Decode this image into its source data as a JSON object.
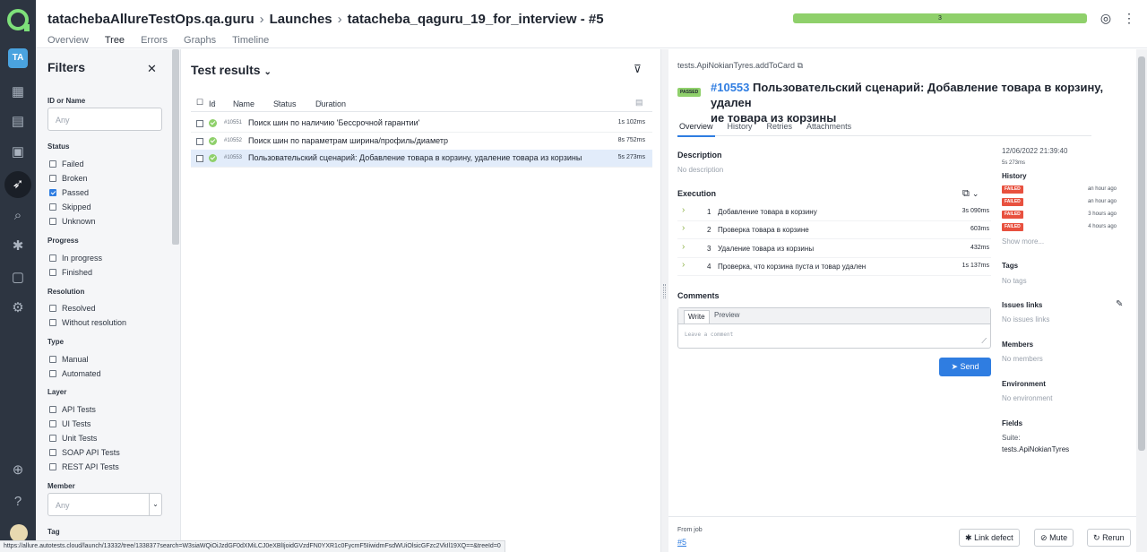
{
  "header": {
    "project": "tatachebaAllureTestOps.qa.guru",
    "section": "Launches",
    "launch": "tatacheba_qaguru_19_for_interview - #5",
    "tabs": [
      "Overview",
      "Tree",
      "Errors",
      "Graphs",
      "Timeline"
    ],
    "active_tab": "Tree",
    "progress_label": "3",
    "progress_fraction": 1.0
  },
  "rail": {
    "user_initials": "TA"
  },
  "filters": {
    "title": "Filters",
    "id_label": "ID or Name",
    "id_placeholder": "Any",
    "status_label": "Status",
    "status": [
      "Failed",
      "Broken",
      "Passed",
      "Skipped",
      "Unknown"
    ],
    "status_checked": "Passed",
    "progress_label": "Progress",
    "progress": [
      "In progress",
      "Finished"
    ],
    "resolution_label": "Resolution",
    "resolution": [
      "Resolved",
      "Without resolution"
    ],
    "type_label": "Type",
    "type": [
      "Manual",
      "Automated"
    ],
    "layer_label": "Layer",
    "layer": [
      "API Tests",
      "UI Tests",
      "Unit Tests",
      "SOAP API Tests",
      "REST API Tests"
    ],
    "member_label": "Member",
    "member_placeholder": "Any",
    "tag_label": "Tag"
  },
  "results": {
    "title": "Test results",
    "columns": [
      "Id",
      "Name",
      "Status",
      "Duration"
    ],
    "rows": [
      {
        "id": "#10551",
        "name": "Поиск шин по наличию 'Бессрочной гарантии'",
        "duration": "1s 102ms",
        "status": "passed"
      },
      {
        "id": "#10552",
        "name": "Поиск шин по параметрам ширина/профиль/диаметр",
        "duration": "8s 752ms",
        "status": "passed"
      },
      {
        "id": "#10553",
        "name": "Пользовательский сценарий: Добавление товара в корзину, удаление товара из корзины",
        "duration": "5s 273ms",
        "status": "passed",
        "selected": true
      }
    ]
  },
  "details": {
    "path": "tests.ApiNokianTyres.addToCard",
    "status": "PASSED",
    "id": "#10553",
    "title_line1": "Пользовательский сценарий: Добавление товара в корзину, удален",
    "title_line2": "ие товара из корзины",
    "tabs": [
      "Overview",
      "History",
      "Retries",
      "Attachments"
    ],
    "active_tab": "Overview",
    "description_label": "Description",
    "description": "No description",
    "execution_label": "Execution",
    "steps": [
      {
        "num": "1",
        "name": "Добавление товара в корзину",
        "duration": "3s 090ms"
      },
      {
        "num": "2",
        "name": "Проверка товара в корзине",
        "duration": "603ms"
      },
      {
        "num": "3",
        "name": "Удаление товара из корзины",
        "duration": "432ms"
      },
      {
        "num": "4",
        "name": "Проверка, что корзина пуста и товар удален",
        "duration": "1s 137ms"
      }
    ],
    "comments_label": "Comments",
    "comment_tabs": [
      "Write",
      "Preview"
    ],
    "comment_placeholder": "Leave a comment",
    "send_label": "Send",
    "date": "12/06/2022 21:39:40",
    "duration": "5s 273ms",
    "history_label": "History",
    "history": [
      {
        "status": "FAILED",
        "time": "an hour ago"
      },
      {
        "status": "FAILED",
        "time": "an hour ago"
      },
      {
        "status": "FAILED",
        "time": "3 hours ago"
      },
      {
        "status": "FAILED",
        "time": "4 hours ago"
      }
    ],
    "show_more": "Show more...",
    "tags_label": "Tags",
    "tags_empty": "No tags",
    "issues_label": "Issues links",
    "issues_empty": "No issues links",
    "members_label": "Members",
    "members_empty": "No members",
    "environment_label": "Environment",
    "environment_empty": "No environment",
    "fields_label": "Fields",
    "fields_key": "Suite:",
    "fields_value": "tests.ApiNokianTyres",
    "from_job_label": "From job",
    "from_job_link": "#5",
    "buttons": {
      "link_defect": "Link defect",
      "mute": "Mute",
      "rerun": "Rerun"
    }
  },
  "statusbar": {
    "url": "https://allure.autotests.cloud/launch/13332/tree/1338377search=W3siaWQiOiJzdGF0dXMiLCJ0eXBlIjoidGVzdFN0YXR1c0FycmF5IiwidmFsdWUiOlsicGFzc2VkIl19XQ==&treeId=0"
  },
  "colors": {
    "accent": "#2f7de1",
    "passed": "#8fd06b",
    "failed": "#e8513f",
    "rail": "#2d3541"
  }
}
